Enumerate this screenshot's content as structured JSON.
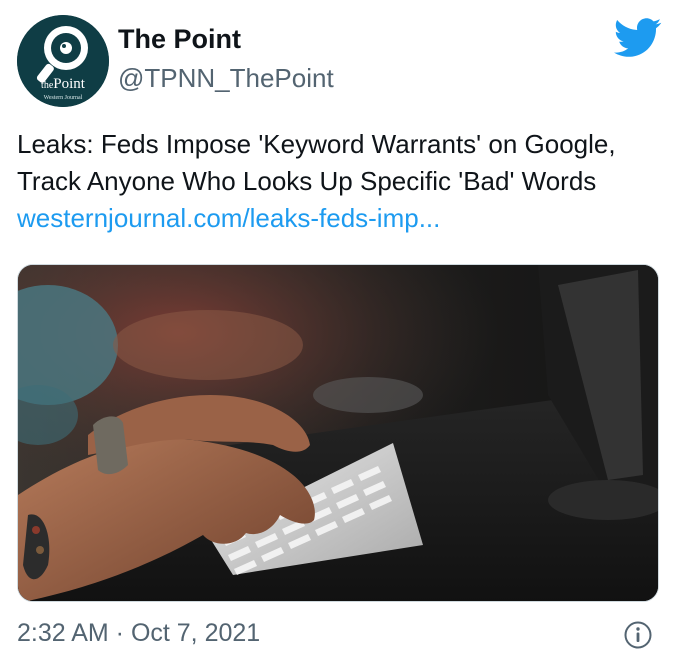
{
  "tweet": {
    "author": {
      "display_name": "The Point",
      "handle": "@TPNN_ThePoint",
      "avatar_label_prefix": "the",
      "avatar_label_main": "Point",
      "avatar_sub": "Western Journal"
    },
    "text_line": "Leaks: Feds Impose 'Keyword Warrants' on Google, Track Anyone Who Looks Up Specific 'Bad' Words",
    "link_text": "westernjournal.com/leaks-feds-imp...",
    "timestamp": "2:32 AM · Oct 7, 2021",
    "media": {
      "icon": "photo-hands-typing-on-keyboard"
    },
    "icons": {
      "brand": "twitter-bird-icon",
      "info": "info-icon"
    },
    "colors": {
      "link": "#1d9bf0",
      "twitter_blue": "#1d9bf0",
      "secondary_text": "#536471"
    }
  }
}
